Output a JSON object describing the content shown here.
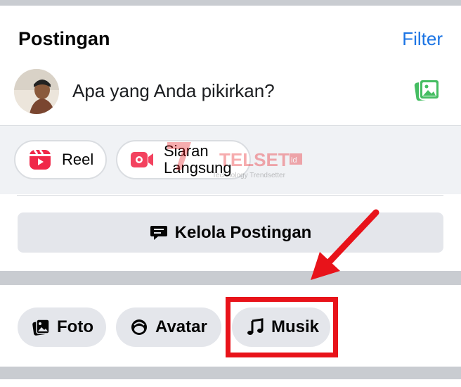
{
  "header": {
    "title": "Postingan",
    "filter_label": "Filter"
  },
  "composer": {
    "placeholder": "Apa yang Anda pikirkan?"
  },
  "actions": {
    "reel_label": "Reel",
    "live_label_line1": "Siaran",
    "live_label_line2": "Langsung"
  },
  "manage": {
    "label": "Kelola Postingan"
  },
  "chips": [
    {
      "label": "Foto"
    },
    {
      "label": "Avatar"
    },
    {
      "label": "Musik"
    }
  ],
  "watermark": {
    "brand": "TELSET",
    "suffix": "id",
    "tagline": "Technology Trendsetter"
  },
  "colors": {
    "accent_blue": "#1b74e4",
    "reel_red": "#f02849",
    "live_red": "#f3425f",
    "photo_green": "#45bd62",
    "highlight_red": "#e8131a"
  }
}
